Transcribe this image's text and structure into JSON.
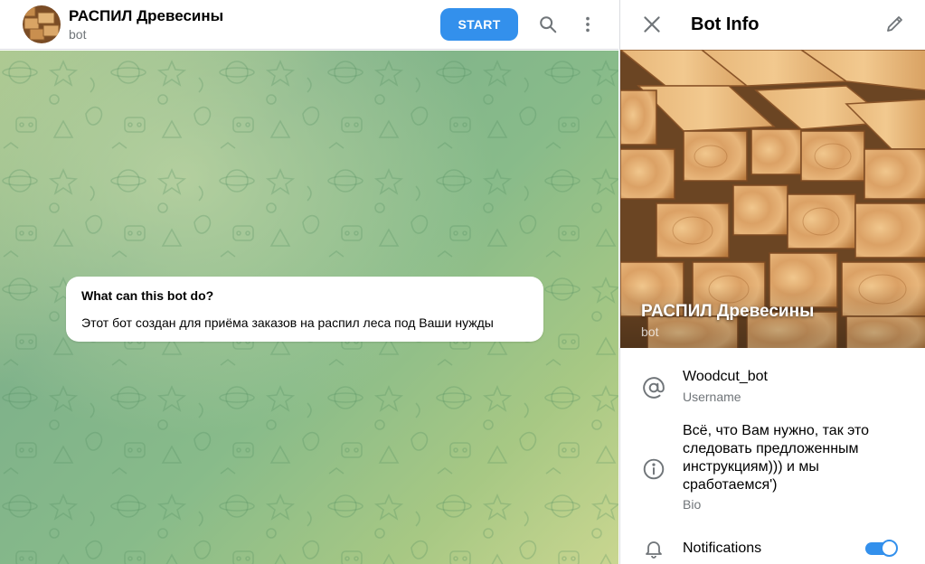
{
  "chat": {
    "title": "РАСПИЛ Древесины",
    "subtitle": "bot",
    "start_label": "START",
    "icons": {
      "search": "search-icon",
      "more": "more-vertical-icon"
    }
  },
  "intro": {
    "title": "What can this bot do?",
    "text": "Этот бот создан для приёма заказов на распил леса под Ваши нужды"
  },
  "info": {
    "header_title": "Bot Info",
    "icons": {
      "close": "close-icon",
      "edit": "pencil-icon"
    },
    "cover_name": "РАСПИЛ Древесины",
    "cover_sub": "bot",
    "username": "Woodcut_bot",
    "username_label": "Username",
    "bio": "Всё, что Вам нужно, так это следовать предложенным инструкциям))) и мы сработаемся')",
    "bio_label": "Bio",
    "notifications_label": "Notifications",
    "notifications_on": true
  },
  "colors": {
    "accent": "#3390ec",
    "secondary_text": "#707579",
    "chat_bg": "#8bbd8c"
  }
}
